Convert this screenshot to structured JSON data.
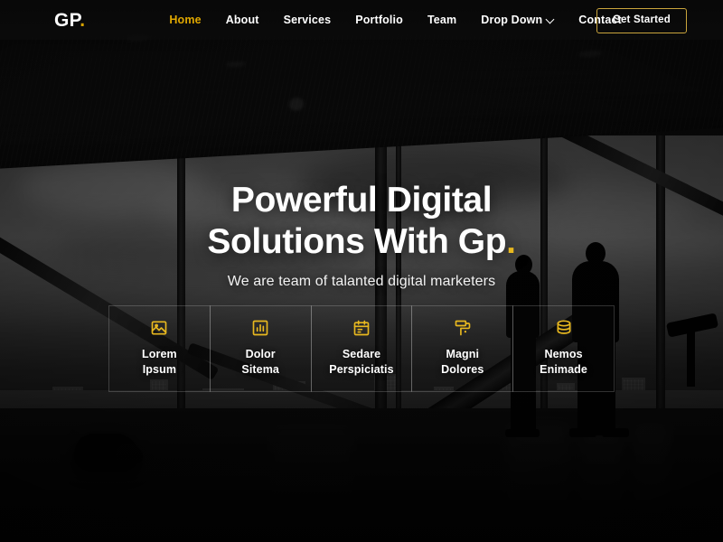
{
  "header": {
    "logo_text": "GP",
    "logo_dot": ".",
    "nav": [
      {
        "label": "Home",
        "active": true,
        "icon": null
      },
      {
        "label": "About",
        "active": false,
        "icon": null
      },
      {
        "label": "Services",
        "active": false,
        "icon": null
      },
      {
        "label": "Portfolio",
        "active": false,
        "icon": null
      },
      {
        "label": "Team",
        "active": false,
        "icon": null
      },
      {
        "label": "Drop Down",
        "active": false,
        "icon": "chevron-down-icon"
      },
      {
        "label": "Contact",
        "active": false,
        "icon": null
      }
    ],
    "cta_label": "Get Started"
  },
  "hero": {
    "title_line1": "Powerful Digital",
    "title_line2": "Solutions With Gp",
    "title_dot": ".",
    "subtitle": "We are team of talanted digital marketers"
  },
  "features": [
    {
      "icon": "image-icon",
      "line1": "Lorem",
      "line2": "Ipsum"
    },
    {
      "icon": "bar-chart-icon",
      "line1": "Dolor",
      "line2": "Sitema"
    },
    {
      "icon": "calendar-icon",
      "line1": "Sedare",
      "line2": "Perspiciatis"
    },
    {
      "icon": "paint-roller-icon",
      "line1": "Magni",
      "line2": "Dolores"
    },
    {
      "icon": "database-icon",
      "line1": "Nemos",
      "line2": "Enimade"
    }
  ],
  "colors": {
    "accent_gold": "#e8b81f",
    "nav_active": "#e0a800",
    "logo_dot": "#d9a400",
    "cta_border": "#caa53c",
    "text_white": "#ffffff",
    "header_bg": "#080808",
    "page_bg": "#000000"
  }
}
